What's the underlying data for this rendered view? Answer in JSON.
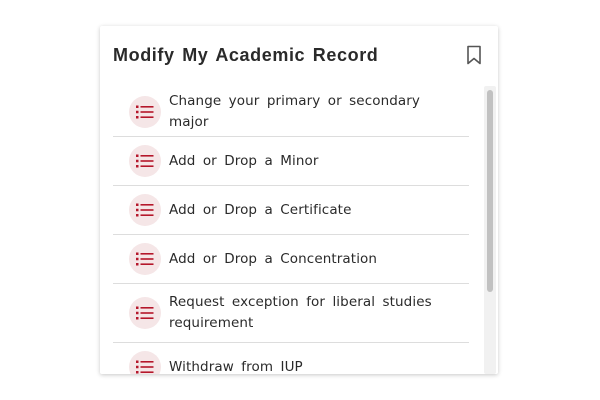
{
  "card": {
    "title": "Modify My Academic Record",
    "bookmark_icon": "bookmark-icon"
  },
  "items": [
    {
      "label": "Change your primary or secondary major",
      "icon": "list-icon"
    },
    {
      "label": "Add or Drop a Minor",
      "icon": "list-icon"
    },
    {
      "label": "Add or Drop a Certificate",
      "icon": "list-icon"
    },
    {
      "label": "Add or Drop a Concentration",
      "icon": "list-icon"
    },
    {
      "label": "Request exception for liberal studies requirement",
      "icon": "list-icon"
    },
    {
      "label": "Withdraw from IUP",
      "icon": "list-icon"
    }
  ],
  "colors": {
    "accent": "#b5172b",
    "icon_bg": "#f5e6e7",
    "divider": "#dddddd",
    "text": "#2a2a2a"
  }
}
